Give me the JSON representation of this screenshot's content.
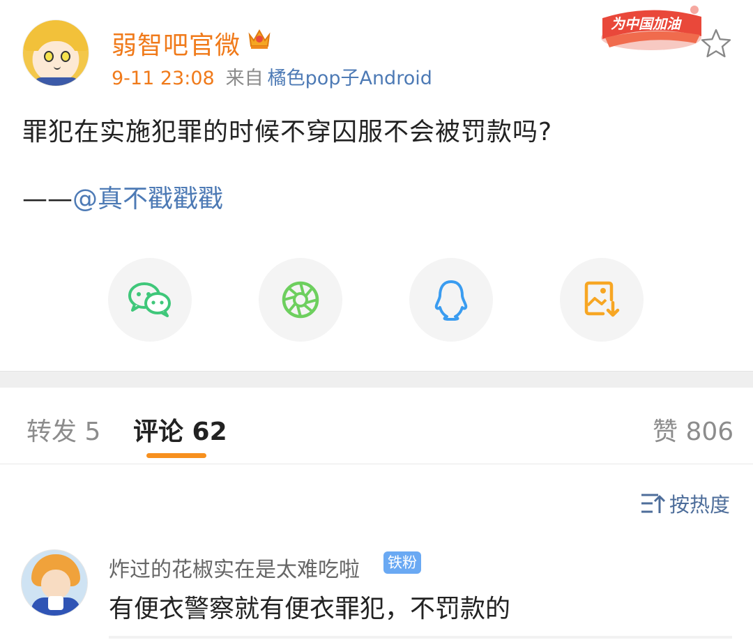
{
  "post": {
    "author": "弱智吧官微",
    "time": "9-11 23:08",
    "from_label": "来自",
    "client": "橘色pop子Android",
    "badge_text": "为中国加油",
    "text": "罪犯在实施犯罪的时候不穿囚服不会被罚款吗?",
    "credit_dash": "——",
    "credit_mention": "@真不戳戳戳"
  },
  "share": [
    {
      "icon": "wechat-icon",
      "color": "#3fc77a"
    },
    {
      "icon": "moments-icon",
      "color": "#6dcf5e"
    },
    {
      "icon": "qq-icon",
      "color": "#3a9cf0"
    },
    {
      "icon": "save-image-icon",
      "color": "#f7a623"
    }
  ],
  "tabs": {
    "repost": "转发 5",
    "comments": "评论 62",
    "likes": "赞 806"
  },
  "sort": {
    "label": "按热度"
  },
  "comment": {
    "user": "炸过的花椒实在是太难吃啦",
    "badge": "铁粉",
    "text": "有便衣警察就有便衣罪犯，不罚款的"
  },
  "colors": {
    "accent": "#f07a1a",
    "link": "#4d7ab5",
    "tab_indicator": "#f7901e"
  }
}
